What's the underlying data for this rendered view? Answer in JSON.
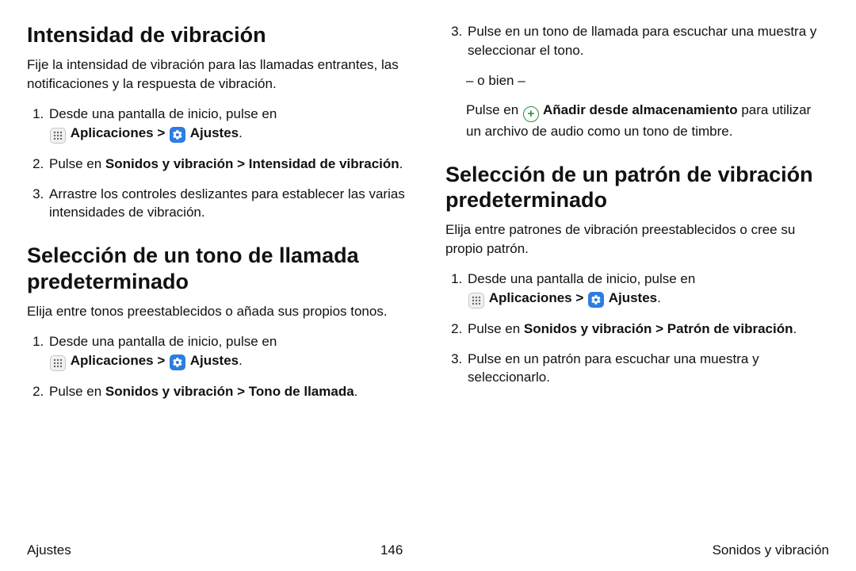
{
  "section1": {
    "heading": "Intensidad de vibración",
    "intro": "Fije la intensidad de vibración para las llamadas entrantes, las notificaciones y la respuesta de vibración.",
    "step1_pre": "Desde una pantalla de inicio, pulse en ",
    "apps_label": "Aplicaciones",
    "chevron": " > ",
    "settings_label": "Ajustes",
    "period": ".",
    "step2_pre": "Pulse en ",
    "step2_bold": "Sonidos y vibración > Intensidad de vibración",
    "step3": "Arrastre los controles deslizantes para establecer las varias intensidades de vibración."
  },
  "section2": {
    "heading": "Selección de un tono de llamada predeterminado",
    "intro": "Elija entre tonos preestablecidos o añada sus propios tonos.",
    "step1_pre": "Desde una pantalla de inicio, pulse en ",
    "apps_label": "Aplicaciones",
    "chevron": " > ",
    "settings_label": "Ajustes",
    "period": ".",
    "step2_pre": "Pulse en ",
    "step2_bold": "Sonidos y vibración > Tono de llamada",
    "step3": "Pulse en un tono de llamada para escuchar una muestra y seleccionar el tono.",
    "or_text": "– o bien –",
    "step3b_pre": "Pulse en ",
    "step3b_bold": " Añadir desde almacenamiento",
    "step3b_post": " para utilizar un archivo de audio como un tono de timbre."
  },
  "section3": {
    "heading": "Selección de un patrón de vibración predeterminado",
    "intro": "Elija entre patrones de vibración preestablecidos o cree su propio patrón.",
    "step1_pre": "Desde una pantalla de inicio, pulse en ",
    "apps_label": "Aplicaciones",
    "chevron": " > ",
    "settings_label": "Ajustes",
    "period": ".",
    "step2_pre": "Pulse en ",
    "step2_bold": "Sonidos y vibración > Patrón de vibración",
    "step3": "Pulse en un patrón para escuchar una muestra y seleccionarlo."
  },
  "footer": {
    "left": "Ajustes",
    "center": "146",
    "right": "Sonidos y vibración"
  }
}
